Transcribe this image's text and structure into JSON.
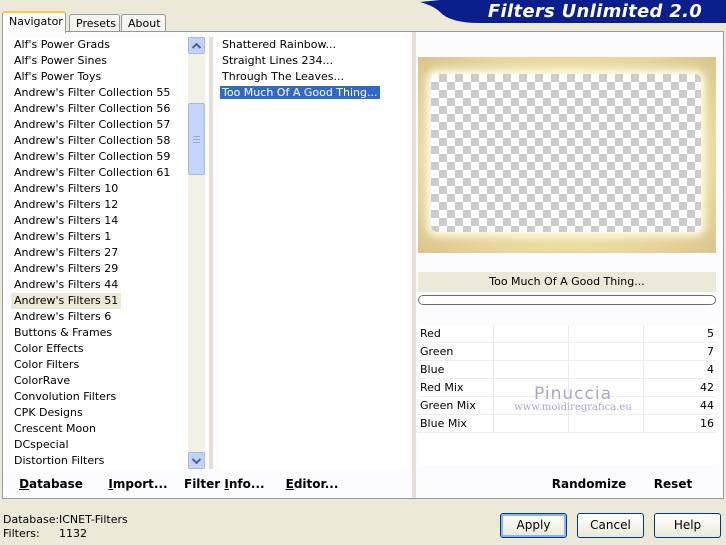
{
  "tabs": [
    "Navigator",
    "Presets",
    "About"
  ],
  "banner": {
    "title": "Filters Unlimited 2.0",
    "color": "#0a1e8c"
  },
  "categories": [
    "Alf's Power Grads",
    "Alf's Power Sines",
    "Alf's Power Toys",
    "Andrew's Filter Collection 55",
    "Andrew's Filter Collection 56",
    "Andrew's Filter Collection 57",
    "Andrew's Filter Collection 58",
    "Andrew's Filter Collection 59",
    "Andrew's Filter Collection 61",
    "Andrew's Filters 10",
    "Andrew's Filters 12",
    "Andrew's Filters 14",
    "Andrew's Filters 1",
    "Andrew's Filters 27",
    "Andrew's Filters 29",
    "Andrew's Filters 44",
    "Andrew's Filters 51",
    "Andrew's Filters 6",
    "Buttons & Frames",
    "Color Effects",
    "Color Filters",
    "ColorRave",
    "Convolution Filters",
    "CPK Designs",
    "Crescent Moon",
    "DCspecial",
    "Distortion Filters"
  ],
  "selected_category": "Andrew's Filters 51",
  "filters": [
    "Shattered Rainbow...",
    "Straight Lines 234...",
    "Through The Leaves...",
    "Too Much Of A Good Thing..."
  ],
  "selected_filter": "Too Much Of A Good Thing...",
  "preview": {
    "filter_name": "Too Much Of A Good Thing..."
  },
  "progress": 0,
  "params": [
    {
      "label": "Red",
      "value": "5"
    },
    {
      "label": "Green",
      "value": "7"
    },
    {
      "label": "Blue",
      "value": "4"
    },
    {
      "label": "Red Mix",
      "value": "42"
    },
    {
      "label": "Green Mix",
      "value": "44"
    },
    {
      "label": "Blue Mix",
      "value": "16"
    }
  ],
  "watermark": {
    "name": "Pinuccia",
    "url": "www.moidiregrafica.eu"
  },
  "frame_buttons": {
    "database": {
      "pre": "",
      "ul": "D",
      "post": "atabase"
    },
    "import": {
      "pre": "",
      "ul": "I",
      "post": "mport..."
    },
    "filter_info": {
      "pre": "Filter ",
      "ul": "I",
      "post": "nfo..."
    },
    "editor": {
      "pre": "",
      "ul": "E",
      "post": "ditor..."
    },
    "randomize": "Randomize",
    "reset": "Reset"
  },
  "status": {
    "database_label": "Database:",
    "database_value": "ICNET-Filters",
    "filters_label": "Filters:",
    "filters_value": "1132"
  },
  "footer_buttons": {
    "apply": "Apply",
    "cancel": "Cancel",
    "help": "Help"
  }
}
